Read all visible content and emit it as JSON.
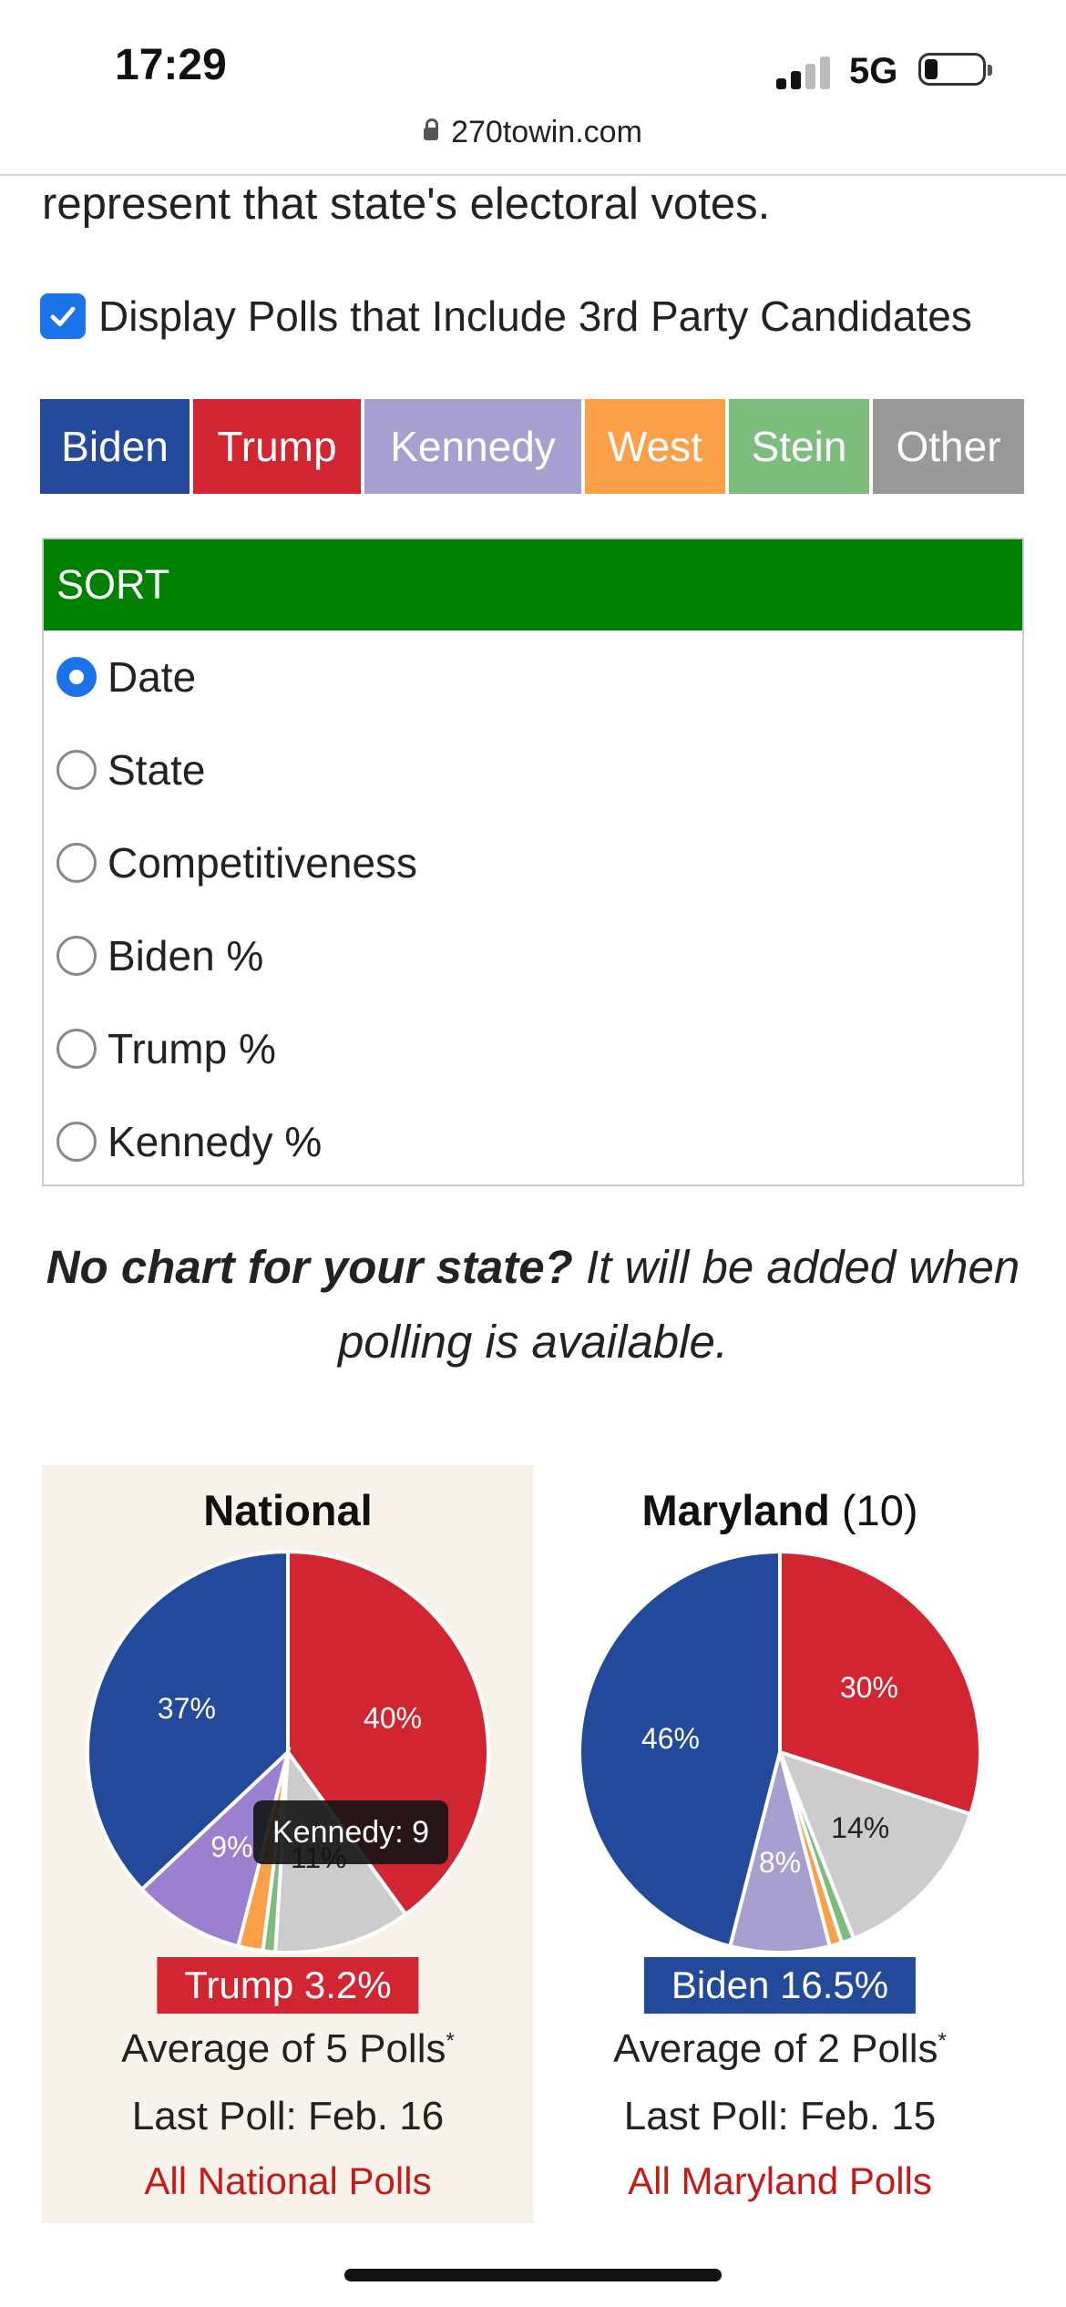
{
  "status_bar": {
    "time": "17:29",
    "network": "5G"
  },
  "browser": {
    "url": "270towin.com"
  },
  "intro_text": "represent that state's electoral votes.",
  "third_party_checkbox": {
    "label": "Display Polls that Include 3rd Party Candidates",
    "checked": true
  },
  "legend": [
    {
      "label": "Biden",
      "color": "#234a9a"
    },
    {
      "label": "Trump",
      "color": "#d22532"
    },
    {
      "label": "Kennedy",
      "color": "#a79fd0"
    },
    {
      "label": "West",
      "color": "#faa048"
    },
    {
      "label": "Stein",
      "color": "#7cbd7e"
    },
    {
      "label": "Other",
      "color": "#999999"
    }
  ],
  "sort": {
    "header": "SORT",
    "options": [
      {
        "label": "Date",
        "selected": true
      },
      {
        "label": "State",
        "selected": false
      },
      {
        "label": "Competitiveness",
        "selected": false
      },
      {
        "label": "Biden %",
        "selected": false
      },
      {
        "label": "Trump %",
        "selected": false
      },
      {
        "label": "Kennedy %",
        "selected": false
      }
    ]
  },
  "note": {
    "bold": "No chart for your state?",
    "rest": "It will be added when polling is available."
  },
  "cards": {
    "national": {
      "title": "National",
      "margin_label": "Trump 3.2%",
      "average": "Average of 5 Polls",
      "asterisk": "*",
      "last_poll": "Last Poll: Feb. 16",
      "link": "All National Polls",
      "tooltip": "Kennedy: 9"
    },
    "maryland": {
      "title": "Maryland",
      "electoral_votes": "(10)",
      "margin_label": "Biden 16.5%",
      "average": "Average of 2 Polls",
      "asterisk": "*",
      "last_poll": "Last Poll: Feb. 15",
      "link": "All Maryland Polls"
    }
  },
  "chart_data": [
    {
      "type": "pie",
      "title": "National",
      "slices": [
        {
          "name": "Trump",
          "value": 40,
          "label": "40%",
          "color": "#d22532"
        },
        {
          "name": "Other",
          "value": 11,
          "label": "11%",
          "color": "#cccccc"
        },
        {
          "name": "Stein",
          "value": 1,
          "label": "",
          "color": "#7cbd7e"
        },
        {
          "name": "West",
          "value": 2,
          "label": "",
          "color": "#faa048"
        },
        {
          "name": "Kennedy",
          "value": 9,
          "label": "9%",
          "color": "#9b80d0"
        },
        {
          "name": "Biden",
          "value": 37,
          "label": "37%",
          "color": "#234a9a"
        }
      ]
    },
    {
      "type": "pie",
      "title": "Maryland",
      "slices": [
        {
          "name": "Trump",
          "value": 30,
          "label": "30%",
          "color": "#d22532"
        },
        {
          "name": "Other",
          "value": 14,
          "label": "14%",
          "color": "#cccccc"
        },
        {
          "name": "Stein",
          "value": 1,
          "label": "",
          "color": "#7cbd7e"
        },
        {
          "name": "West",
          "value": 1,
          "label": "",
          "color": "#faa048"
        },
        {
          "name": "Kennedy",
          "value": 8,
          "label": "8%",
          "color": "#a79fd0"
        },
        {
          "name": "Biden",
          "value": 46,
          "label": "46%",
          "color": "#234a9a"
        }
      ]
    }
  ]
}
